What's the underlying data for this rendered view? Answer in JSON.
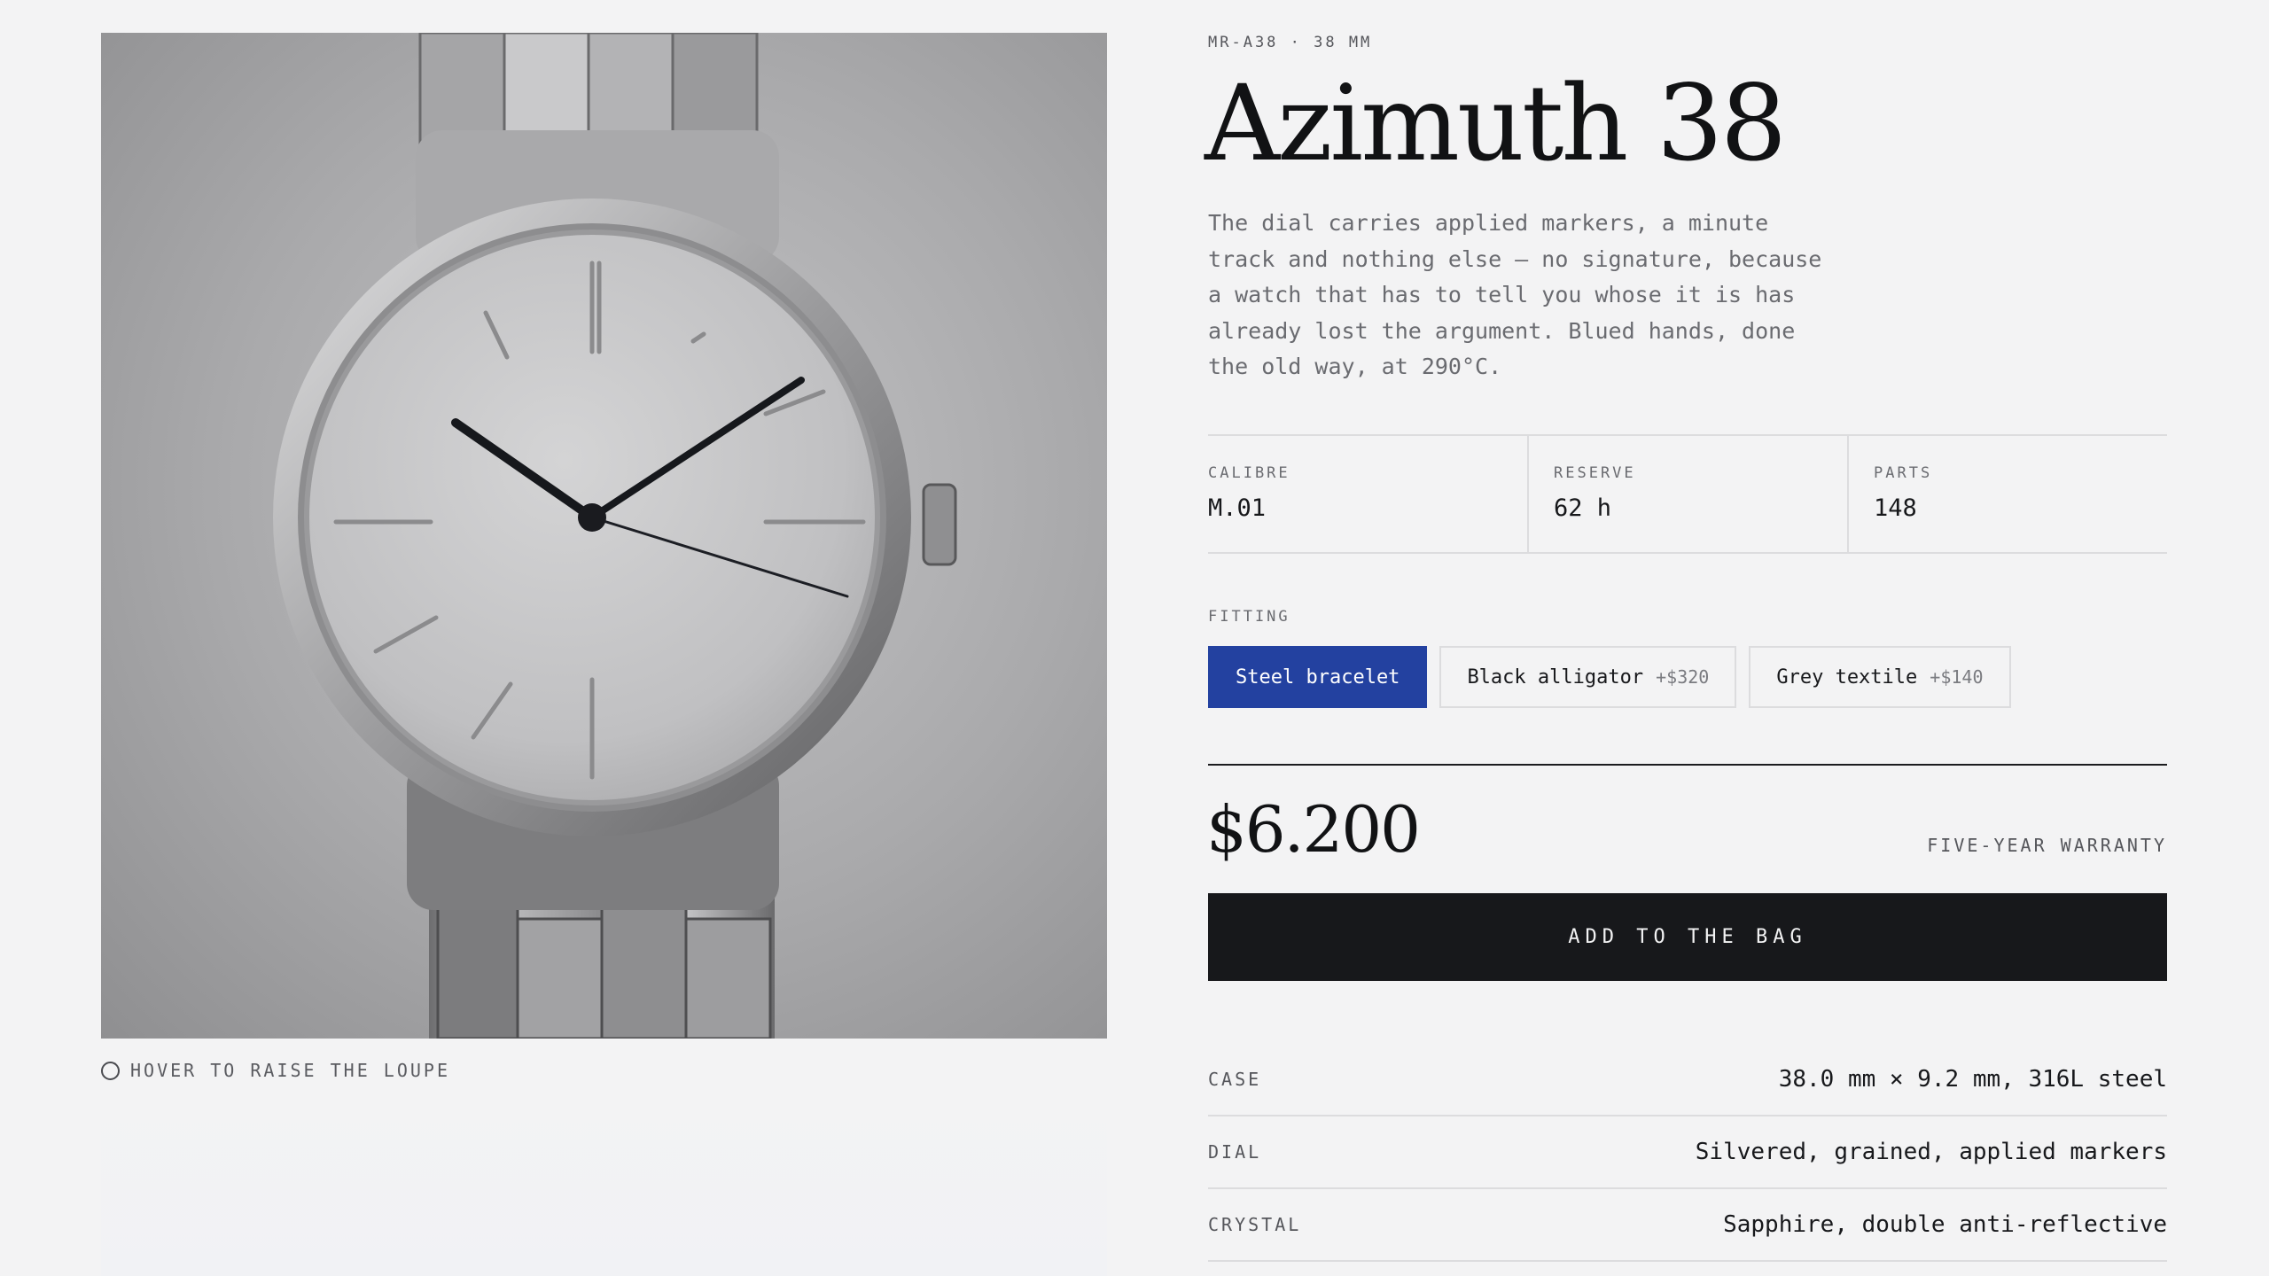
{
  "product": {
    "sku": "MR-A38 · 38 MM",
    "title": "Azimuth 38",
    "description": "The dial carries applied markers, a minute track and nothing else — no signature, because a watch that has to tell you whose it is has already lost the argument. Blued hands, done the old way, at 290°C."
  },
  "gallery": {
    "hint": "HOVER TO RAISE THE LOUPE"
  },
  "specs": [
    {
      "label": "CALIBRE",
      "value": "M.01"
    },
    {
      "label": "RESERVE",
      "value": "62 h"
    },
    {
      "label": "PARTS",
      "value": "148"
    }
  ],
  "fitting": {
    "label": "FITTING",
    "options": [
      {
        "name": "Steel bracelet",
        "extra": "",
        "selected": true
      },
      {
        "name": "Black alligator",
        "extra": "+$320",
        "selected": false
      },
      {
        "name": "Grey textile",
        "extra": "+$140",
        "selected": false
      }
    ]
  },
  "purchase": {
    "price": "$6.200",
    "warranty": "FIVE-YEAR WARRANTY",
    "add_label": "ADD TO THE BAG"
  },
  "details": [
    {
      "label": "CASE",
      "value": "38.0 mm × 9.2 mm, 316L steel"
    },
    {
      "label": "DIAL",
      "value": "Silvered, grained, applied markers"
    },
    {
      "label": "CRYSTAL",
      "value": "Sapphire, double anti-reflective"
    }
  ],
  "colors": {
    "background": "#f3f3f4",
    "ink": "#17181b",
    "accent": "#2341a0"
  }
}
